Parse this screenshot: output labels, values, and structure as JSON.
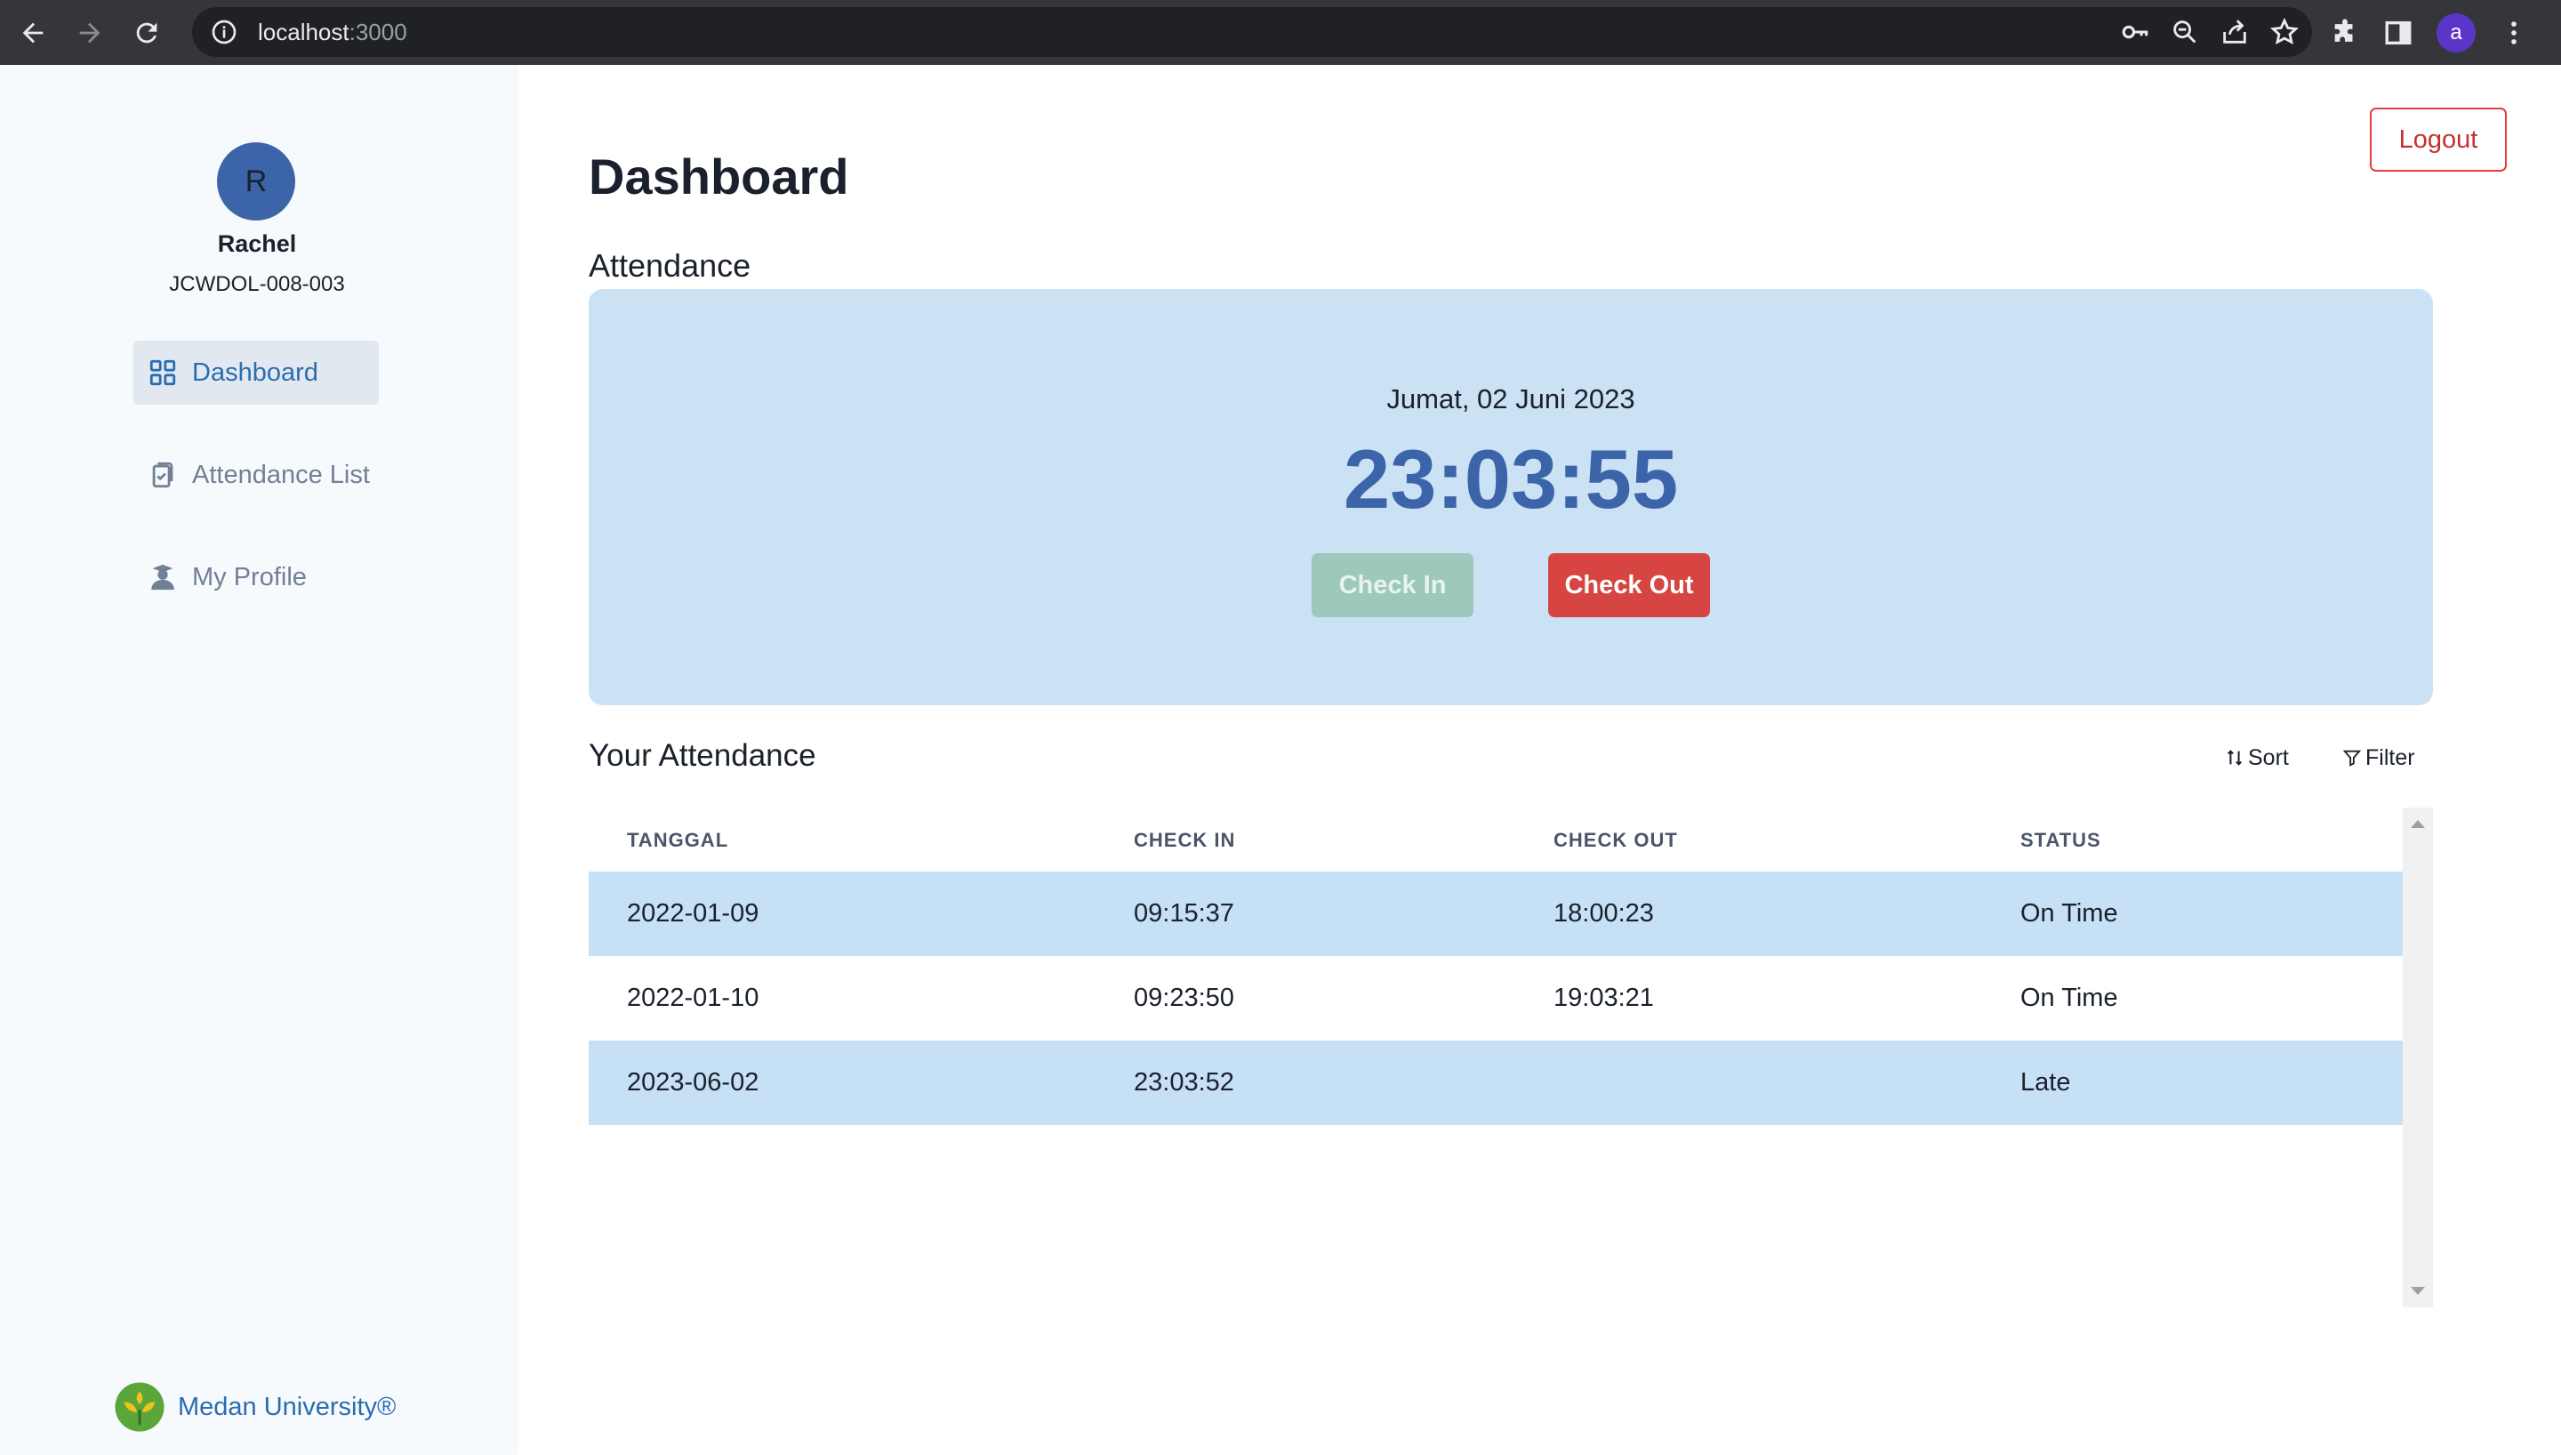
{
  "browser": {
    "url_host": "localhost",
    "url_port": ":3000",
    "profile_initial": "a"
  },
  "sidebar": {
    "avatar_initial": "R",
    "user_name": "Rachel",
    "user_id": "JCWDOL-008-003",
    "items": [
      {
        "label": "Dashboard",
        "icon": "grid-icon",
        "active": true
      },
      {
        "label": "Attendance List",
        "icon": "clipboard-icon",
        "active": false
      },
      {
        "label": "My Profile",
        "icon": "user-graduate-icon",
        "active": false
      }
    ],
    "brand": "Medan University®"
  },
  "header": {
    "logout_label": "Logout",
    "title": "Dashboard"
  },
  "attendance_card": {
    "section_label": "Attendance",
    "date": "Jumat, 02 Juni 2023",
    "time": "23:03:55",
    "check_in_label": "Check In",
    "check_out_label": "Check Out"
  },
  "your_attendance": {
    "title": "Your Attendance",
    "sort_label": "Sort",
    "filter_label": "Filter",
    "columns": [
      "TANGGAL",
      "CHECK IN",
      "CHECK OUT",
      "STATUS"
    ],
    "rows": [
      {
        "tanggal": "2022-01-09",
        "check_in": "09:15:37",
        "check_out": "18:00:23",
        "status": "On Time"
      },
      {
        "tanggal": "2022-01-10",
        "check_in": "09:23:50",
        "check_out": "19:03:21",
        "status": "On Time"
      },
      {
        "tanggal": "2023-06-02",
        "check_in": "23:03:52",
        "check_out": "",
        "status": "Late"
      }
    ]
  },
  "colors": {
    "accent_blue": "#3c64a8",
    "card_bg": "#cbe1f4",
    "check_out_red": "#d64541",
    "check_in_disabled": "#9cc9bb"
  }
}
